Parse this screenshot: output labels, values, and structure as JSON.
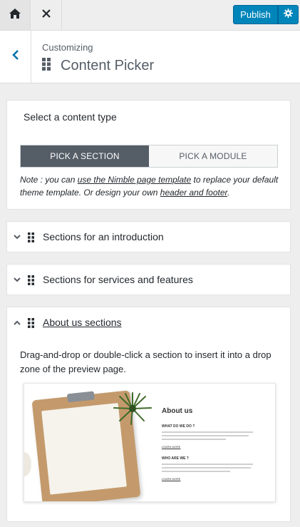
{
  "topbar": {
    "home_icon": "home-icon",
    "close_icon": "close-icon",
    "publish_label": "Publish",
    "settings_icon": "gear-icon",
    "accent": "#0085ba"
  },
  "header": {
    "breadcrumb": "Customizing",
    "title": "Content Picker",
    "back_icon": "chevron-left-icon"
  },
  "content_type": {
    "heading": "Select a content type",
    "tabs": [
      {
        "label": "PICK A SECTION",
        "active": true
      },
      {
        "label": "PICK A MODULE",
        "active": false
      }
    ],
    "note_prefix": "Note : you can ",
    "note_link1": "use the Nimble page template",
    "note_middle": " to replace your default theme template. Or design your own ",
    "note_link2": "header and footer",
    "note_suffix": "."
  },
  "sections": [
    {
      "label": "Sections for an introduction",
      "expanded": false
    },
    {
      "label": "Sections for services and features",
      "expanded": false
    },
    {
      "label": "About us sections",
      "expanded": true,
      "description": "Drag-and-drop or double-click a section to insert it into a drop zone of the preview page.",
      "preview": {
        "title": "About us",
        "heading1": "WHAT DO WE DO ?",
        "heading2": "WHO ARE WE ?",
        "link": "LEARN MORE"
      }
    }
  ]
}
